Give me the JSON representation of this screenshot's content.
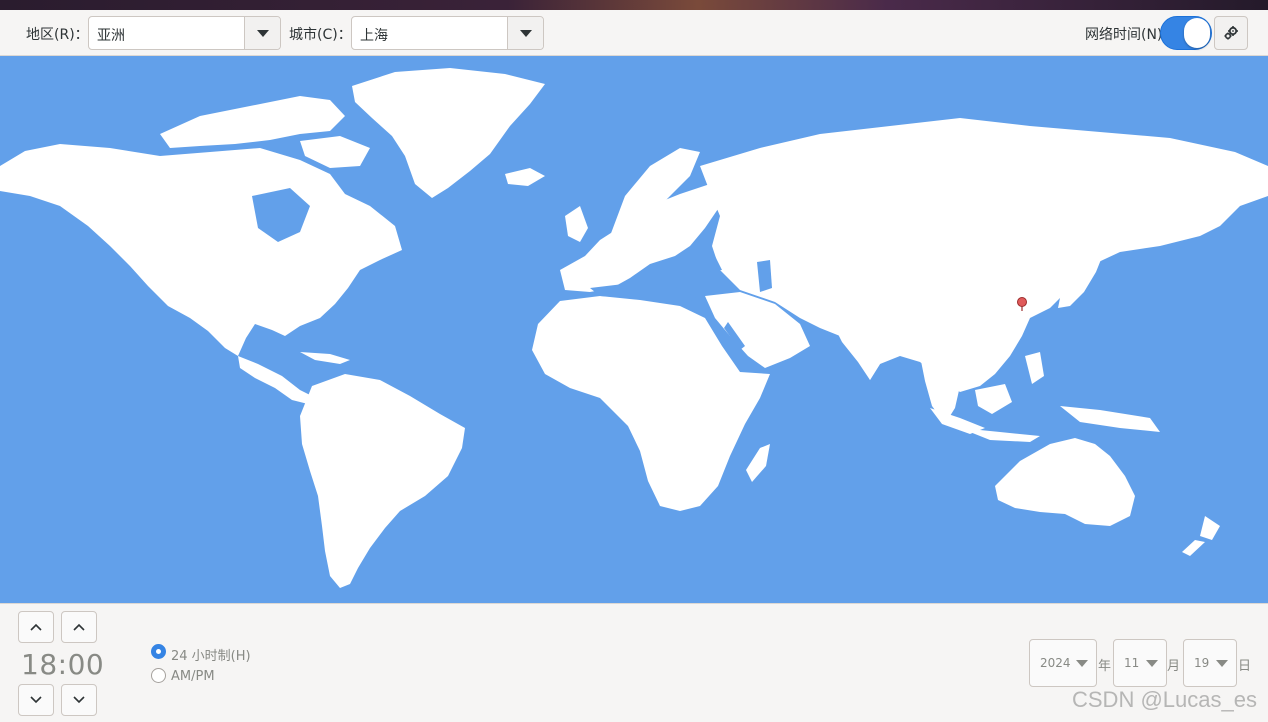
{
  "toolbar": {
    "region_label": "地区(R)：",
    "region_value": "亚洲",
    "city_label": "城市(C)：",
    "city_value": "上海",
    "network_time_label": "网络时间(N)",
    "network_time_on": true
  },
  "map": {
    "ocean_color": "#62a0ea",
    "land_color": "#ffffff",
    "marker_color": "#e05a5a",
    "selected_city": "上海"
  },
  "time": {
    "display": "18:00",
    "format_24h_label": "24 小时制(H)",
    "format_ampm_label": "AM/PM",
    "selected_format": "24h"
  },
  "date": {
    "year": "2024",
    "year_unit": "年",
    "month": "11",
    "month_unit": "月",
    "day": "19",
    "day_unit": "日"
  },
  "watermark": "CSDN @Lucas_es",
  "colors": {
    "accent": "#3584e4"
  }
}
